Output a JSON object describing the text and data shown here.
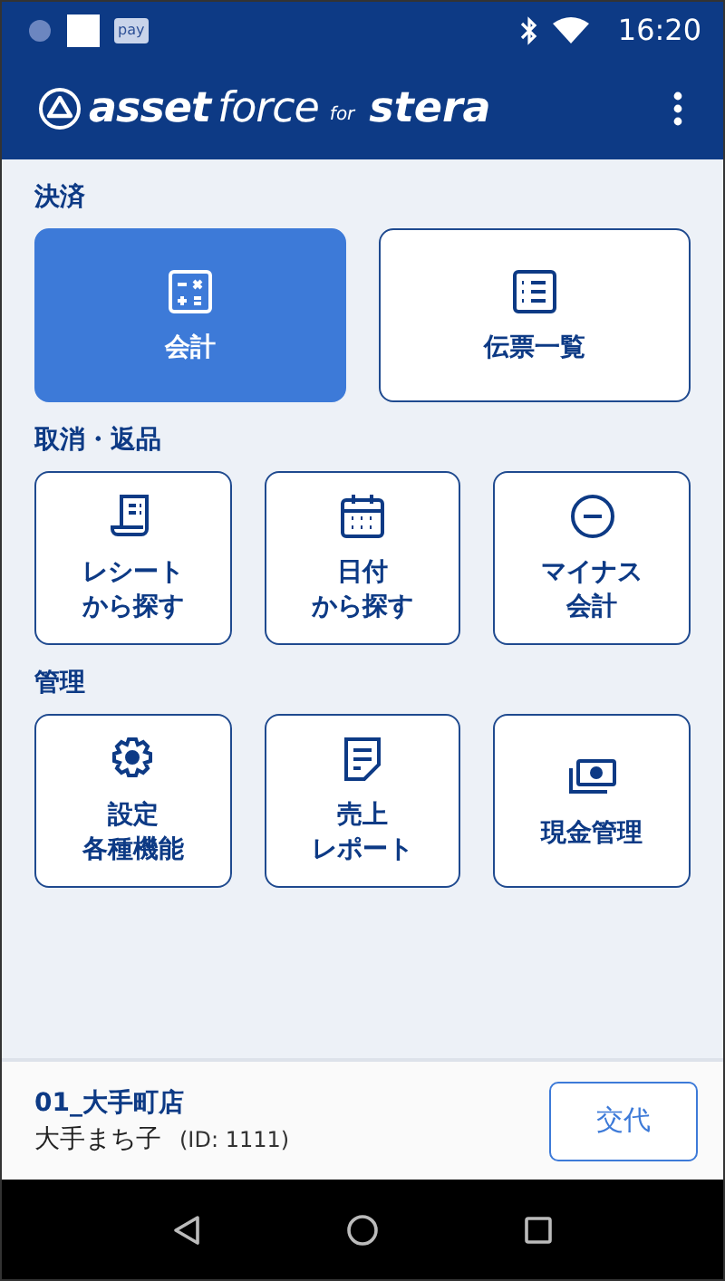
{
  "status_bar": {
    "app_badge": "pay",
    "time": "16:20"
  },
  "app_bar": {
    "logo": [
      "asset",
      "force",
      "for",
      "stera"
    ]
  },
  "sections": [
    {
      "title": "決済",
      "buttons": [
        {
          "lines": [
            "会計"
          ],
          "selected": true
        },
        {
          "lines": [
            "伝票一覧"
          ],
          "selected": false
        }
      ]
    },
    {
      "title": "取消・返品",
      "buttons": [
        {
          "lines": [
            "レシート",
            "から探す"
          ],
          "selected": false
        },
        {
          "lines": [
            "日付",
            "から探す"
          ],
          "selected": false
        },
        {
          "lines": [
            "マイナス",
            "会計"
          ],
          "selected": false
        }
      ]
    },
    {
      "title": "管理",
      "buttons": [
        {
          "lines": [
            "設定",
            "各種機能"
          ],
          "selected": false
        },
        {
          "lines": [
            "売上",
            "レポート"
          ],
          "selected": false
        },
        {
          "lines": [
            "現金管理"
          ],
          "selected": false
        }
      ]
    }
  ],
  "footer": {
    "store": "01_大手町店",
    "user": "大手まち子",
    "user_id": "(ID: 1111)",
    "button": "交代"
  }
}
